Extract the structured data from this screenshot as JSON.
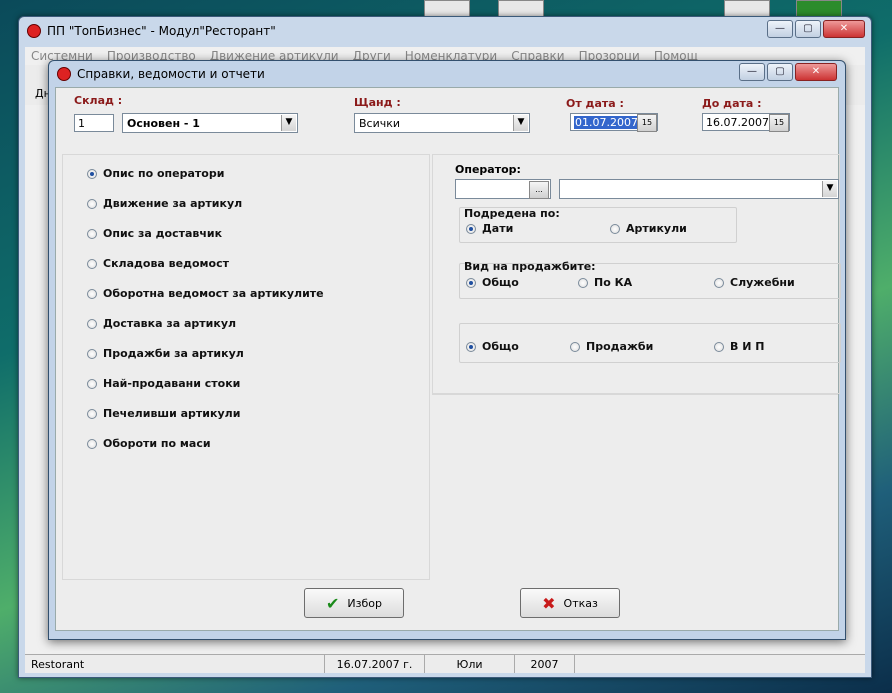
{
  "app": {
    "title": "ПП \"ТопБизнес\" - Модул\"Ресторант\"",
    "menu": [
      "Системни",
      "Производство",
      "Движение артикули",
      "Други",
      "Номенклатури",
      "Справки",
      "Прозорци",
      "Помощ"
    ],
    "toolbar_label": "Дн",
    "status": {
      "app": "Restorant",
      "date": "16.07.2007 г.",
      "month": "Юли",
      "year": "2007"
    }
  },
  "dialog": {
    "title": "Справки, ведомости и отчети",
    "sklad": {
      "label": "Склад :",
      "code": "1",
      "name": "Основен  - 1"
    },
    "shtand": {
      "label": "Щанд :",
      "value": "Всички"
    },
    "from_date": {
      "label": "От дата :",
      "value": "01.07.2007"
    },
    "to_date": {
      "label": "До дата :",
      "value": "16.07.2007"
    },
    "date_btn": "15",
    "reports": [
      "Опис по оператори",
      "Движение за артикул",
      "Опис за доставчик",
      "Складова ведомост",
      "Оборотна ведомост за артикулите",
      "Доставка за артикул",
      "Продажби за артикул",
      "Най-продавани стоки",
      "Печеливши артикули",
      "Обороти по маси"
    ],
    "operator": {
      "label": "Оператор:",
      "code": "",
      "name": "",
      "browse": "..."
    },
    "sorted_by": {
      "label": "Подредена по:",
      "options": [
        "Дати",
        "Артикули"
      ]
    },
    "sales_kind": {
      "label": "Вид на продажбите:",
      "options": [
        "Общо",
        "По КА",
        "Служебни"
      ]
    },
    "third_group": {
      "options": [
        "Общо",
        "Продажби",
        "В И П"
      ]
    },
    "buttons": {
      "ok": "Избор",
      "cancel": "Отказ"
    }
  }
}
